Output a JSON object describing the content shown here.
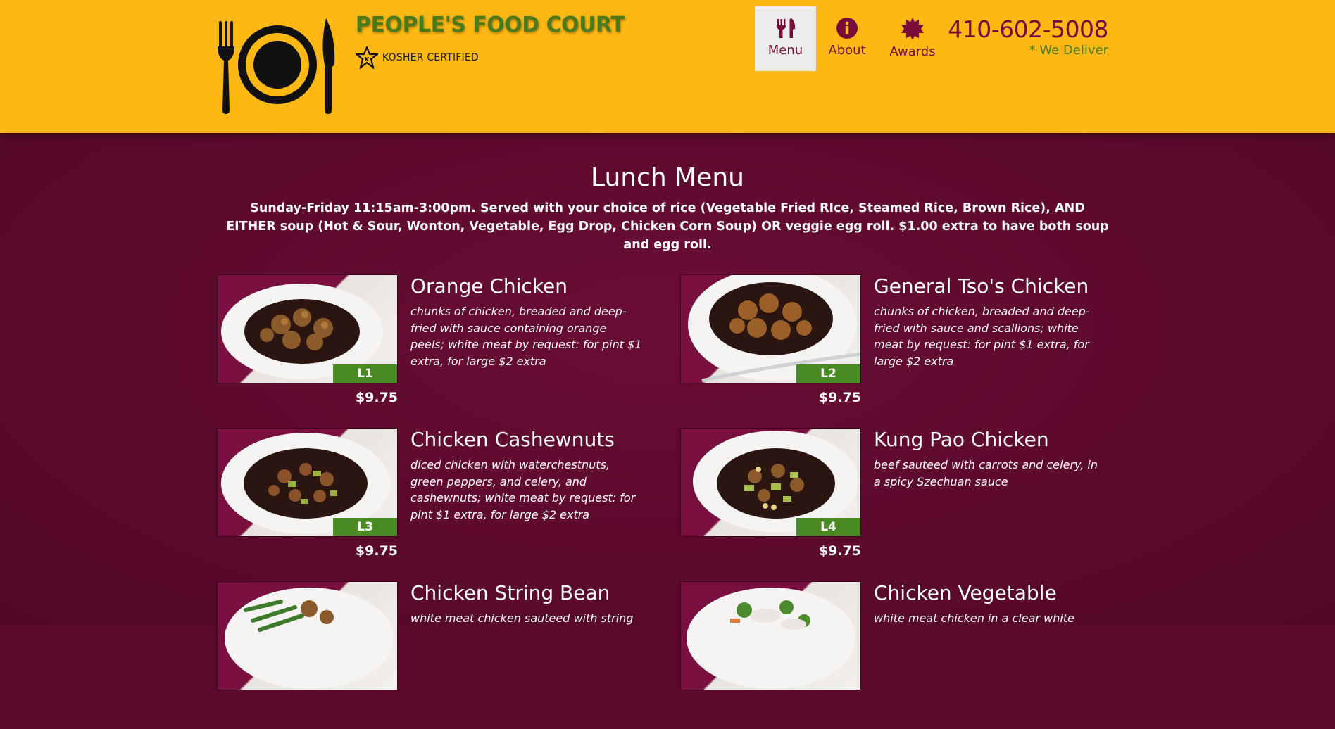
{
  "brand": {
    "name": "PEOPLE'S FOOD COURT",
    "certification": "KOSHER CERTIFIED",
    "colors": {
      "header_bg": "#fdb813",
      "main_bg": "#5c0a2c",
      "accent": "#7a0b39",
      "green": "#4a7a1c",
      "badge": "#4a8a23"
    }
  },
  "nav": {
    "items": [
      {
        "label": "Menu",
        "icon": "utensils-icon",
        "active": true
      },
      {
        "label": "About",
        "icon": "info-icon",
        "active": false
      },
      {
        "label": "Awards",
        "icon": "award-badge-icon",
        "active": false
      }
    ]
  },
  "contact": {
    "phone": "410-602-5008",
    "note": "* We Deliver"
  },
  "menu": {
    "title": "Lunch Menu",
    "description": "Sunday-Friday 11:15am-3:00pm. Served with your choice of rice (Vegetable Fried RIce, Steamed Rice, Brown Rice), AND EITHER soup (Hot & Sour, Wonton, Vegetable, Egg Drop, Chicken Corn Soup) OR veggie egg roll. $1.00 extra to have both soup and egg roll.",
    "items": [
      {
        "code": "L1",
        "name": "Orange Chicken",
        "description": "chunks of chicken, breaded and deep-fried with sauce containing orange peels; white meat by request: for pint $1 extra, for large $2 extra",
        "price": "$9.75"
      },
      {
        "code": "L2",
        "name": "General Tso's Chicken",
        "description": "chunks of chicken, breaded and deep-fried with sauce and scallions; white meat by request: for pint $1 extra, for large $2 extra",
        "price": "$9.75"
      },
      {
        "code": "L3",
        "name": "Chicken Cashewnuts",
        "description": "diced chicken with waterchestnuts, green peppers, and celery, and cashewnuts; white meat by request: for pint $1 extra, for large $2 extra",
        "price": "$9.75"
      },
      {
        "code": "L4",
        "name": "Kung Pao Chicken",
        "description": "beef sauteed with carrots and celery, in a spicy Szechuan sauce",
        "price": "$9.75"
      },
      {
        "code": "",
        "name": "Chicken String Bean",
        "description": "white meat chicken sauteed with string",
        "price": ""
      },
      {
        "code": "",
        "name": "Chicken Vegetable",
        "description": "white meat chicken in a clear white",
        "price": ""
      }
    ]
  }
}
